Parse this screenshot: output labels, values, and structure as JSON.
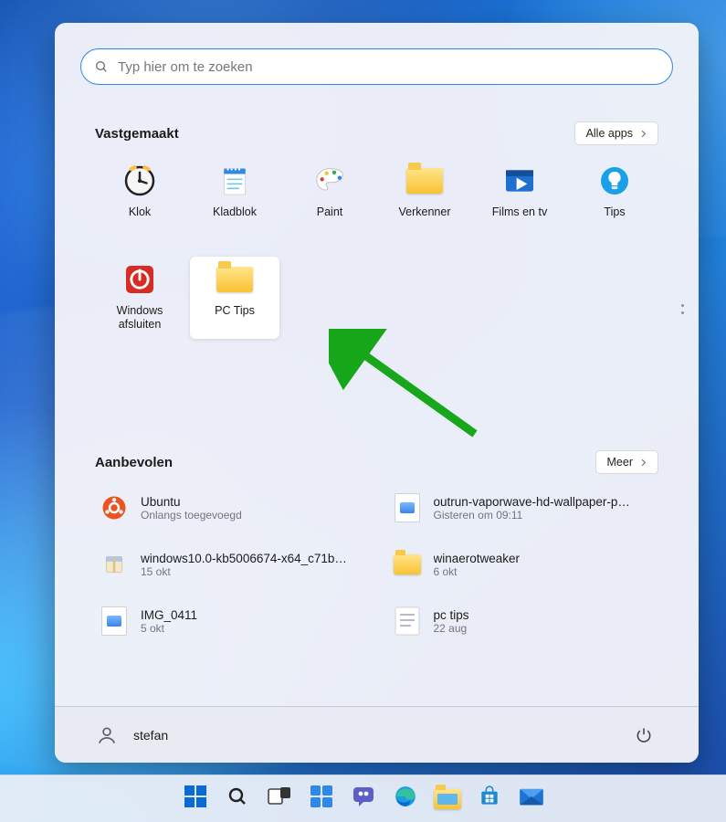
{
  "search": {
    "placeholder": "Typ hier om te zoeken"
  },
  "pinned": {
    "title": "Vastgemaakt",
    "all_apps": "Alle apps",
    "items": [
      {
        "label": "Klok",
        "icon": "clock"
      },
      {
        "label": "Kladblok",
        "icon": "notepad"
      },
      {
        "label": "Paint",
        "icon": "paint"
      },
      {
        "label": "Verkenner",
        "icon": "folder"
      },
      {
        "label": "Films en tv",
        "icon": "films"
      },
      {
        "label": "Tips",
        "icon": "tips"
      },
      {
        "label": "Windows afsluiten",
        "icon": "power-red"
      },
      {
        "label": "PC Tips",
        "icon": "folder",
        "highlighted": true
      }
    ]
  },
  "recommended": {
    "title": "Aanbevolen",
    "more": "Meer",
    "items": [
      {
        "title": "Ubuntu",
        "sub": "Onlangs toegevoegd",
        "icon": "ubuntu"
      },
      {
        "title": "outrun-vaporwave-hd-wallpaper-p…",
        "sub": "Gisteren om 09:11",
        "icon": "image"
      },
      {
        "title": "windows10.0-kb5006674-x64_c71b…",
        "sub": "15 okt",
        "icon": "package"
      },
      {
        "title": "winaerotweaker",
        "sub": "6 okt",
        "icon": "folder"
      },
      {
        "title": "IMG_0411",
        "sub": "5 okt",
        "icon": "image"
      },
      {
        "title": "pc tips",
        "sub": "22 aug",
        "icon": "text"
      }
    ]
  },
  "footer": {
    "username": "stefan"
  },
  "taskbar": {
    "items": [
      "start",
      "search",
      "taskview",
      "widgets",
      "chat",
      "edge",
      "explorer",
      "store",
      "mail"
    ]
  },
  "annotation": {
    "arrow_color": "#18a61a"
  }
}
